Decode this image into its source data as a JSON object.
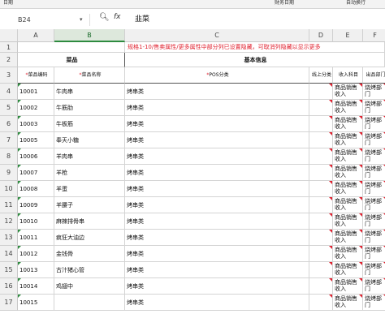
{
  "toolbar": {
    "items": [
      "日期",
      "",
      "",
      "",
      "",
      "",
      "",
      "财务日期",
      "",
      "",
      "自动换行"
    ]
  },
  "formula_bar": {
    "name_box": "B24",
    "fx_label": "fx",
    "value": "韭菜"
  },
  "columns": [
    "A",
    "B",
    "C",
    "D",
    "E",
    "F"
  ],
  "selected_column": "B",
  "rows": {
    "r1_notice": "规格1-10/售卖属性/更多属性中部分列已设置隐藏，可取消列隐藏以显示更多",
    "r2": {
      "dish": "菜品",
      "basic": "基本信息"
    },
    "r3": {
      "code": "菜品编码",
      "name": "菜品名称",
      "pos": "POS分类",
      "d": "线上分类",
      "e": "收入科目",
      "f": "出品部门"
    },
    "data": [
      {
        "row": "4",
        "code": "10001",
        "name": "牛肉串",
        "pos": "烤串类",
        "e": "商品销售收入",
        "f": "烧烤部门"
      },
      {
        "row": "5",
        "code": "10002",
        "name": "牛筋肋",
        "pos": "烤串类",
        "e": "商品销售收入",
        "f": "烧烤部门"
      },
      {
        "row": "6",
        "code": "10003",
        "name": "牛板筋",
        "pos": "烤串类",
        "e": "商品销售收入",
        "f": "烧烤部门"
      },
      {
        "row": "7",
        "code": "10005",
        "name": "奉天小糖",
        "pos": "烤串类",
        "e": "商品销售收入",
        "f": "烧烤部门"
      },
      {
        "row": "8",
        "code": "10006",
        "name": "羊肉串",
        "pos": "烤串类",
        "e": "商品销售收入",
        "f": "烧烤部门"
      },
      {
        "row": "9",
        "code": "10007",
        "name": "羊枪",
        "pos": "烤串类",
        "e": "商品销售收入",
        "f": "烧烤部门"
      },
      {
        "row": "10",
        "code": "10008",
        "name": "羊蛋",
        "pos": "烤串类",
        "e": "商品销售收入",
        "f": "烧烤部门"
      },
      {
        "row": "11",
        "code": "10009",
        "name": "羊腰子",
        "pos": "烤串类",
        "e": "商品销售收入",
        "f": "烧烤部门"
      },
      {
        "row": "12",
        "code": "10010",
        "name": "麻辣排骨串",
        "pos": "烤串类",
        "e": "商品销售收入",
        "f": "烧烤部门"
      },
      {
        "row": "13",
        "code": "10011",
        "name": "疯狂大油边",
        "pos": "烤串类",
        "e": "商品销售收入",
        "f": "烧烤部门"
      },
      {
        "row": "14",
        "code": "10012",
        "name": "金钱骨",
        "pos": "烤串类",
        "e": "商品销售收入",
        "f": "烧烤部门"
      },
      {
        "row": "15",
        "code": "10013",
        "name": "古汁猪心管",
        "pos": "烤串类",
        "e": "商品销售收入",
        "f": "烧烤部门"
      },
      {
        "row": "16",
        "code": "10014",
        "name": "鸡翅中",
        "pos": "烤串类",
        "e": "商品销售收入",
        "f": "烧烤部门"
      },
      {
        "row": "17",
        "code": "10015",
        "name": "",
        "pos": "烤串类",
        "e": "商品销售收入",
        "f": "烧烤部门"
      }
    ]
  },
  "colors": {
    "accent": "#2e8b3f",
    "notice": "#e0202e"
  }
}
